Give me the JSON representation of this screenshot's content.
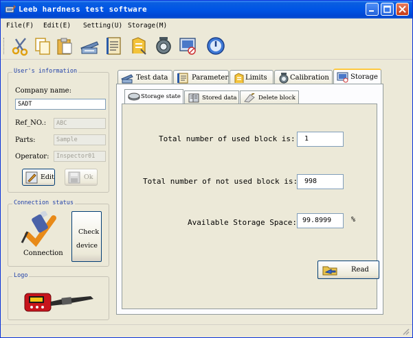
{
  "window": {
    "title": "Leeb hardness test software"
  },
  "menu": {
    "items": [
      "File(F)",
      "Edit(E)",
      "Setting(U)",
      "Storage(M)"
    ]
  },
  "toolbar": {
    "icons": [
      "scissors-icon",
      "copy-icon",
      "paste-icon",
      "test-data-icon",
      "parameter-icon",
      "limits-icon",
      "calibration-icon",
      "storage-icon",
      "power-icon"
    ]
  },
  "user_info": {
    "legend": "User's information",
    "company_label": "Company name:",
    "company_value": "SADT",
    "ref_label": "Ref_NO.:",
    "ref_value": "ABC",
    "parts_label": "Parts:",
    "parts_value": "Sample",
    "operator_label": "Operator:",
    "operator_value": "Inspector01",
    "edit_label": "Edit",
    "ok_label": "Ok"
  },
  "connection": {
    "legend": "Connection status",
    "status_label": "Connection",
    "check_label_1": "Check",
    "check_label_2": "device"
  },
  "logo": {
    "legend": "Logo"
  },
  "tabs": {
    "items": [
      {
        "label": "Test data"
      },
      {
        "label": "Parameter"
      },
      {
        "label": "Limits"
      },
      {
        "label": "Calibration"
      },
      {
        "label": "Storage"
      }
    ],
    "active": "Storage"
  },
  "subtabs": {
    "items": [
      {
        "label": "Storage state"
      },
      {
        "label": "Stored data"
      },
      {
        "label": "Delete block"
      }
    ],
    "active": "Storage state"
  },
  "storage": {
    "used_label": "Total number of used block is:",
    "used_value": "1",
    "not_used_label": "Total number of not used block is:",
    "not_used_value": "998",
    "space_label": "Available Storage Space:",
    "space_value": "99.8999",
    "space_unit": "%",
    "read_label": "Read"
  },
  "colors": {
    "titlebar": "#0055e5",
    "tab_highlight": "#ffc83c",
    "legend_text": "#1f3fa8"
  }
}
